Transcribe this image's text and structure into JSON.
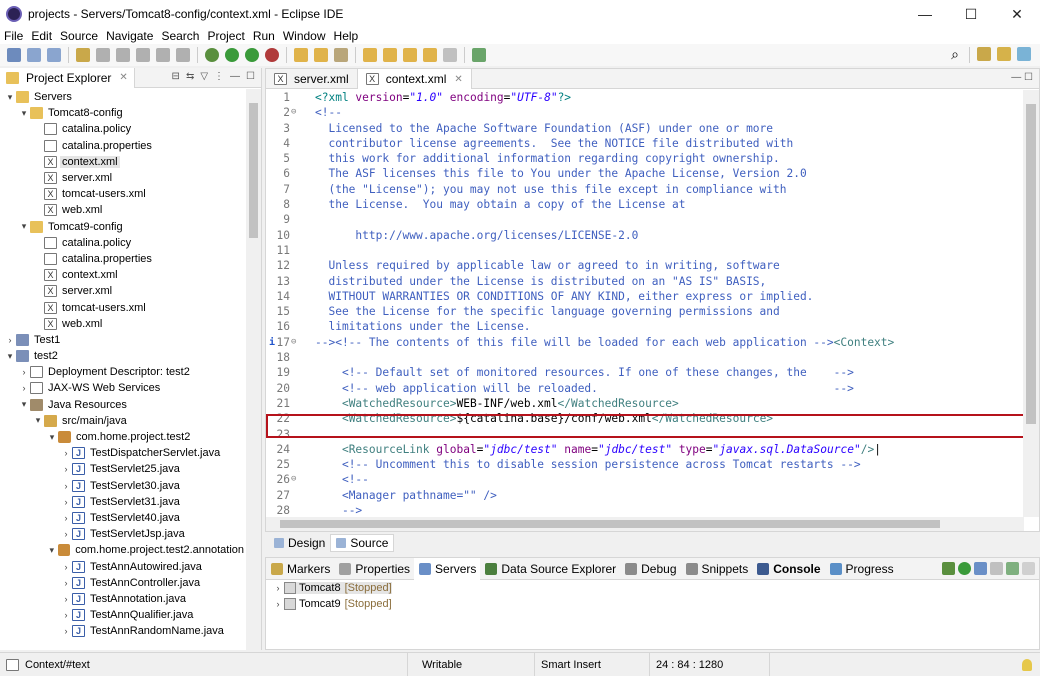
{
  "window": {
    "title": "projects - Servers/Tomcat8-config/context.xml - Eclipse IDE",
    "minimize": "—",
    "maximize": "☐",
    "close": "✕"
  },
  "menu": [
    "File",
    "Edit",
    "Source",
    "Navigate",
    "Search",
    "Project",
    "Run",
    "Window",
    "Help"
  ],
  "explorer": {
    "tab_label": "Project Explorer",
    "tree": [
      {
        "depth": 0,
        "twisty": "▾",
        "icon": "folder",
        "label": "Servers"
      },
      {
        "depth": 1,
        "twisty": "▾",
        "icon": "folder",
        "label": "Tomcat8-config"
      },
      {
        "depth": 2,
        "twisty": "",
        "icon": "file",
        "label": "catalina.policy"
      },
      {
        "depth": 2,
        "twisty": "",
        "icon": "file",
        "label": "catalina.properties"
      },
      {
        "depth": 2,
        "twisty": "",
        "icon": "xml",
        "label": "context.xml",
        "selected": true
      },
      {
        "depth": 2,
        "twisty": "",
        "icon": "xml",
        "label": "server.xml"
      },
      {
        "depth": 2,
        "twisty": "",
        "icon": "xml",
        "label": "tomcat-users.xml"
      },
      {
        "depth": 2,
        "twisty": "",
        "icon": "xml",
        "label": "web.xml"
      },
      {
        "depth": 1,
        "twisty": "▾",
        "icon": "folder",
        "label": "Tomcat9-config"
      },
      {
        "depth": 2,
        "twisty": "",
        "icon": "file",
        "label": "catalina.policy"
      },
      {
        "depth": 2,
        "twisty": "",
        "icon": "file",
        "label": "catalina.properties"
      },
      {
        "depth": 2,
        "twisty": "",
        "icon": "xml",
        "label": "context.xml"
      },
      {
        "depth": 2,
        "twisty": "",
        "icon": "xml",
        "label": "server.xml"
      },
      {
        "depth": 2,
        "twisty": "",
        "icon": "xml",
        "label": "tomcat-users.xml"
      },
      {
        "depth": 2,
        "twisty": "",
        "icon": "xml",
        "label": "web.xml"
      },
      {
        "depth": 0,
        "twisty": "›",
        "icon": "project",
        "label": "Test1"
      },
      {
        "depth": 0,
        "twisty": "▾",
        "icon": "project",
        "label": "test2"
      },
      {
        "depth": 1,
        "twisty": "›",
        "icon": "file",
        "label": "Deployment Descriptor: test2"
      },
      {
        "depth": 1,
        "twisty": "›",
        "icon": "file",
        "label": "JAX-WS Web Services"
      },
      {
        "depth": 1,
        "twisty": "▾",
        "icon": "jar",
        "label": "Java Resources"
      },
      {
        "depth": 2,
        "twisty": "▾",
        "icon": "src",
        "label": "src/main/java"
      },
      {
        "depth": 3,
        "twisty": "▾",
        "icon": "pkg",
        "label": "com.home.project.test2"
      },
      {
        "depth": 4,
        "twisty": "›",
        "icon": "java",
        "label": "TestDispatcherServlet.java"
      },
      {
        "depth": 4,
        "twisty": "›",
        "icon": "java",
        "label": "TestServlet25.java"
      },
      {
        "depth": 4,
        "twisty": "›",
        "icon": "java",
        "label": "TestServlet30.java"
      },
      {
        "depth": 4,
        "twisty": "›",
        "icon": "java",
        "label": "TestServlet31.java"
      },
      {
        "depth": 4,
        "twisty": "›",
        "icon": "java",
        "label": "TestServlet40.java"
      },
      {
        "depth": 4,
        "twisty": "›",
        "icon": "java",
        "label": "TestServletJsp.java"
      },
      {
        "depth": 3,
        "twisty": "▾",
        "icon": "pkg",
        "label": "com.home.project.test2.annotation"
      },
      {
        "depth": 4,
        "twisty": "›",
        "icon": "java",
        "label": "TestAnnAutowired.java"
      },
      {
        "depth": 4,
        "twisty": "›",
        "icon": "java",
        "label": "TestAnnController.java"
      },
      {
        "depth": 4,
        "twisty": "›",
        "icon": "java",
        "label": "TestAnnotation.java"
      },
      {
        "depth": 4,
        "twisty": "›",
        "icon": "java",
        "label": "TestAnnQualifier.java"
      },
      {
        "depth": 4,
        "twisty": "›",
        "icon": "java",
        "label": "TestAnnRandomName.java"
      }
    ]
  },
  "editor": {
    "tabs": [
      {
        "label": "server.xml",
        "active": false
      },
      {
        "label": "context.xml",
        "active": true
      }
    ],
    "lines": [
      {
        "n": "1",
        "fold": "",
        "segs": [
          [
            "pi",
            "<?xml "
          ],
          [
            "attr",
            "version"
          ],
          [
            "plain",
            "="
          ],
          [
            "val",
            "\"1.0\""
          ],
          [
            "plain",
            " "
          ],
          [
            "attr",
            "encoding"
          ],
          [
            "plain",
            "="
          ],
          [
            "val",
            "\"UTF-8\""
          ],
          [
            "pi",
            "?>"
          ]
        ]
      },
      {
        "n": "2",
        "fold": "⊖",
        "segs": [
          [
            "comment",
            "<!--"
          ]
        ]
      },
      {
        "n": "3",
        "fold": "",
        "segs": [
          [
            "comment",
            "  Licensed to the Apache Software Foundation (ASF) under one or more"
          ]
        ]
      },
      {
        "n": "4",
        "fold": "",
        "segs": [
          [
            "comment",
            "  contributor license agreements.  See the NOTICE file distributed with"
          ]
        ]
      },
      {
        "n": "5",
        "fold": "",
        "segs": [
          [
            "comment",
            "  this work for additional information regarding copyright ownership."
          ]
        ]
      },
      {
        "n": "6",
        "fold": "",
        "segs": [
          [
            "comment",
            "  The ASF licenses this file to You under the Apache License, Version 2.0"
          ]
        ]
      },
      {
        "n": "7",
        "fold": "",
        "segs": [
          [
            "comment",
            "  (the \"License\"); you may not use this file except in compliance with"
          ]
        ]
      },
      {
        "n": "8",
        "fold": "",
        "segs": [
          [
            "comment",
            "  the License.  You may obtain a copy of the License at"
          ]
        ]
      },
      {
        "n": "9",
        "fold": "",
        "segs": [
          [
            "comment",
            ""
          ]
        ]
      },
      {
        "n": "10",
        "fold": "",
        "segs": [
          [
            "comment",
            "      http://www.apache.org/licenses/LICENSE-2.0"
          ]
        ]
      },
      {
        "n": "11",
        "fold": "",
        "segs": [
          [
            "comment",
            ""
          ]
        ]
      },
      {
        "n": "12",
        "fold": "",
        "segs": [
          [
            "comment",
            "  Unless required by applicable law or agreed to in writing, software"
          ]
        ]
      },
      {
        "n": "13",
        "fold": "",
        "segs": [
          [
            "comment",
            "  distributed under the License is distributed on an \"AS IS\" BASIS,"
          ]
        ]
      },
      {
        "n": "14",
        "fold": "",
        "segs": [
          [
            "comment",
            "  WITHOUT WARRANTIES OR CONDITIONS OF ANY KIND, either express or implied."
          ]
        ]
      },
      {
        "n": "15",
        "fold": "",
        "segs": [
          [
            "comment",
            "  See the License for the specific language governing permissions and"
          ]
        ]
      },
      {
        "n": "16",
        "fold": "",
        "segs": [
          [
            "comment",
            "  limitations under the License."
          ]
        ]
      },
      {
        "n": "17",
        "fold": "⊖",
        "info": "i",
        "segs": [
          [
            "comment",
            "--><!-- The contents of this file will be loaded for each web application -->"
          ],
          [
            "tag",
            "<Context>"
          ]
        ]
      },
      {
        "n": "18",
        "fold": "",
        "segs": [
          [
            "plain",
            ""
          ]
        ]
      },
      {
        "n": "19",
        "fold": "",
        "segs": [
          [
            "plain",
            "    "
          ],
          [
            "comment",
            "<!-- Default set of monitored resources. If one of these changes, the    -->"
          ]
        ]
      },
      {
        "n": "20",
        "fold": "",
        "segs": [
          [
            "plain",
            "    "
          ],
          [
            "comment",
            "<!-- web application will be reloaded.                                   -->"
          ]
        ]
      },
      {
        "n": "21",
        "fold": "",
        "segs": [
          [
            "plain",
            "    "
          ],
          [
            "tag",
            "<WatchedResource>"
          ],
          [
            "plain",
            "WEB-INF/web.xml"
          ],
          [
            "tag",
            "</WatchedResource>"
          ]
        ]
      },
      {
        "n": "22",
        "fold": "",
        "segs": [
          [
            "plain",
            "    "
          ],
          [
            "tag",
            "<WatchedResource>"
          ],
          [
            "plain",
            "${catalina.base}/conf/web.xml"
          ],
          [
            "tag",
            "</WatchedResource>"
          ]
        ]
      },
      {
        "n": "23",
        "fold": "",
        "segs": [
          [
            "plain",
            ""
          ]
        ]
      },
      {
        "n": "24",
        "fold": "",
        "segs": [
          [
            "plain",
            "    "
          ],
          [
            "tag",
            "<ResourceLink "
          ],
          [
            "attr",
            "global"
          ],
          [
            "plain",
            "="
          ],
          [
            "val",
            "\"jdbc/test\""
          ],
          [
            "plain",
            " "
          ],
          [
            "attr",
            "name"
          ],
          [
            "plain",
            "="
          ],
          [
            "val",
            "\"jdbc/test\""
          ],
          [
            "plain",
            " "
          ],
          [
            "attr",
            "type"
          ],
          [
            "plain",
            "="
          ],
          [
            "val",
            "\"javax.sql.DataSource\""
          ],
          [
            "tag",
            "/>"
          ],
          [
            "plain",
            "|"
          ]
        ]
      },
      {
        "n": "25",
        "fold": "",
        "segs": [
          [
            "plain",
            "    "
          ],
          [
            "comment",
            "<!-- Uncomment this to disable session persistence across Tomcat restarts -->"
          ]
        ]
      },
      {
        "n": "26",
        "fold": "⊖",
        "segs": [
          [
            "plain",
            "    "
          ],
          [
            "comment",
            "<!--"
          ]
        ]
      },
      {
        "n": "27",
        "fold": "",
        "segs": [
          [
            "plain",
            "    "
          ],
          [
            "comment",
            "<Manager pathname=\"\" />"
          ]
        ]
      },
      {
        "n": "28",
        "fold": "",
        "segs": [
          [
            "plain",
            "    "
          ],
          [
            "comment",
            "-->"
          ]
        ]
      }
    ]
  },
  "design_source": {
    "design": "Design",
    "source": "Source"
  },
  "bottom": {
    "tabs": [
      {
        "label": "Markers",
        "color": "#c9a84a",
        "active": false,
        "bold": false
      },
      {
        "label": "Properties",
        "color": "#a0a0a0",
        "active": false,
        "bold": false
      },
      {
        "label": "Servers",
        "color": "#6a8fc7",
        "active": true,
        "bold": false
      },
      {
        "label": "Data Source Explorer",
        "color": "#4b7f3e",
        "active": false,
        "bold": false
      },
      {
        "label": "Debug",
        "color": "#8b8b8b",
        "active": false,
        "bold": false
      },
      {
        "label": "Snippets",
        "color": "#8b8b8b",
        "active": false,
        "bold": false
      },
      {
        "label": "Console",
        "color": "#3c5a8f",
        "active": false,
        "bold": true
      },
      {
        "label": "Progress",
        "color": "#5a8fc7",
        "active": false,
        "bold": false
      }
    ],
    "servers": [
      {
        "name": "Tomcat8",
        "status": "[Stopped]",
        "selected": true
      },
      {
        "name": "Tomcat9",
        "status": "[Stopped]",
        "selected": false
      }
    ]
  },
  "status": {
    "path": "Context/#text",
    "mode": "Writable",
    "insert": "Smart Insert",
    "position": "24 : 84 : 1280"
  },
  "colors": {
    "highlight_box": "#b5121b",
    "accent": "#2a00ff"
  }
}
